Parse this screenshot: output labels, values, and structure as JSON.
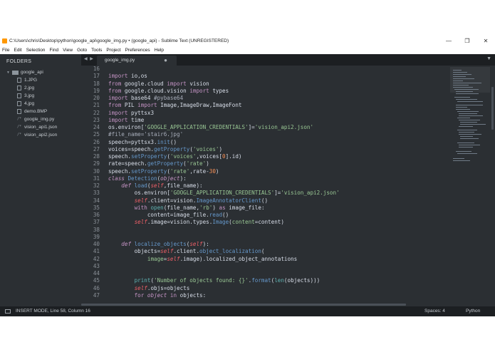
{
  "window": {
    "title": "C:\\Users\\chris\\Desktop\\python\\google_api\\google_img.py • (google_api) - Sublime Text (UNREGISTERED)",
    "minimize_glyph": "—",
    "maximize_glyph": "❐",
    "close_glyph": "✕"
  },
  "menu": [
    "File",
    "Edit",
    "Selection",
    "Find",
    "View",
    "Goto",
    "Tools",
    "Project",
    "Preferences",
    "Help"
  ],
  "sidebar": {
    "header": "FOLDERS",
    "root": "google_api",
    "items": [
      {
        "label": "1.JPG",
        "icon": "image-file-icon"
      },
      {
        "label": "2.jpg",
        "icon": "image-file-icon"
      },
      {
        "label": "3.jpg",
        "icon": "image-file-icon"
      },
      {
        "label": "4.jpg",
        "icon": "image-file-icon"
      },
      {
        "label": "demo.BMP",
        "icon": "image-file-icon"
      },
      {
        "label": "google_img.py",
        "icon": "code-file-icon"
      },
      {
        "label": "vision_api1.json",
        "icon": "code-file-icon"
      },
      {
        "label": "vision_api2.json",
        "icon": "code-file-icon"
      }
    ]
  },
  "tabs": {
    "nav_glyph": "◀ ▶",
    "active_tab": "google_img.py",
    "dirty_glyph": "●",
    "dropdown_glyph": "▼"
  },
  "editor": {
    "line_numbers": [
      "16",
      "17",
      "18",
      "19",
      "20",
      "21",
      "22",
      "23",
      "24",
      "25",
      "26",
      "27",
      "28",
      "29",
      "30",
      "31",
      "32",
      "33",
      "34",
      "35",
      "36",
      "37",
      "38",
      "39",
      "40",
      "41",
      "42",
      "43",
      "44",
      "45",
      "46",
      "47"
    ]
  },
  "status": {
    "mode": "INSERT MODE, Line 58, Column 16",
    "spaces": "Spaces: 4",
    "syntax": "Python"
  },
  "colors": {
    "background": "#2b2f33",
    "keyword": "#c594c5",
    "function": "#6699cc",
    "string": "#99c794",
    "self": "#ec5f67",
    "number": "#f99157"
  }
}
